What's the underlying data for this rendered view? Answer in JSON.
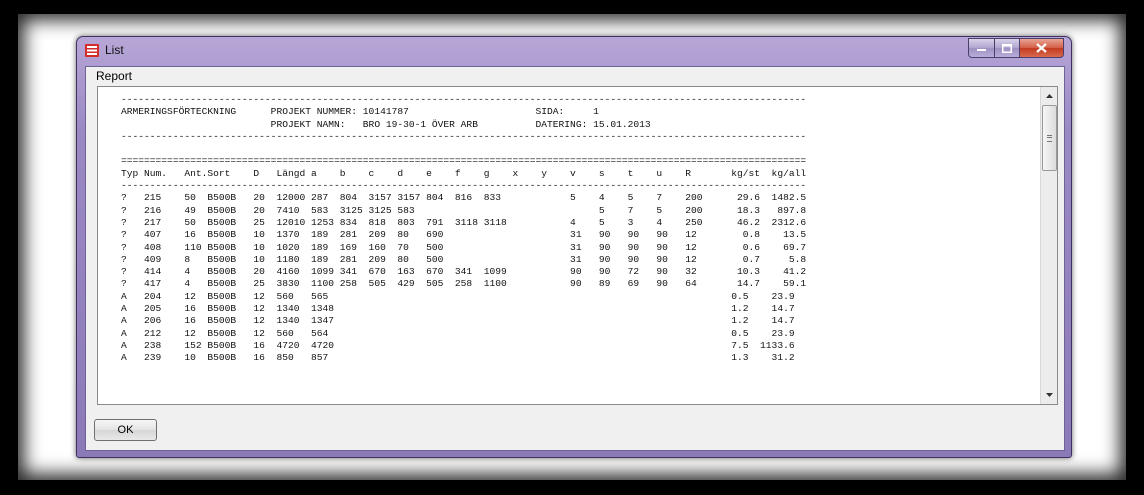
{
  "window": {
    "title": "List"
  },
  "menu": {
    "report_label": "Report"
  },
  "report": {
    "lines": [
      "-----------------------------------------------------------------------------------------------------------------------",
      "ARMERINGSFÖRTECKNING      PROJEKT NUMMER: 10141787                      SIDA:     1",
      "                          PROJEKT NAMN:   BRO 19-30-1 ÖVER ARB          DATERING: 15.01.2013",
      "-----------------------------------------------------------------------------------------------------------------------",
      "",
      "=======================================================================================================================",
      "Typ Num.   Ant.Sort    D   Längd a    b    c    d    e    f    g    x    y    v    s    t    u    R       kg/st  kg/all",
      "-----------------------------------------------------------------------------------------------------------------------",
      "?   215    50  B500B   20  12000 287  804  3157 3157 804  816  833            5    4    5    7    200      29.6  1482.5",
      "?   216    49  B500B   20  7410  583  3125 3125 583                                5    7    5    200      18.3   897.8",
      "?   217    50  B500B   25  12010 1253 834  818  803  791  3118 3118           4    5    3    4    250      46.2  2312.6",
      "?   407    16  B500B   10  1370  189  281  209  80   690                      31   90   90   90   12        0.8    13.5",
      "?   408    110 B500B   10  1020  189  169  160  70   500                      31   90   90   90   12        0.6    69.7",
      "?   409    8   B500B   10  1180  189  281  209  80   500                      31   90   90   90   12        0.7     5.8",
      "?   414    4   B500B   20  4160  1099 341  670  163  670  341  1099           90   90   72   90   32       10.3    41.2",
      "?   417    4   B500B   25  3830  1100 258  505  429  505  258  1100           90   89   69   90   64       14.7    59.1",
      "A   204    12  B500B   12  560   565                                                                      0.5    23.9",
      "A   205    16  B500B   12  1340  1348                                                                     1.2    14.7",
      "A   206    16  B500B   12  1340  1347                                                                     1.2    14.7",
      "A   212    12  B500B   12  560   564                                                                      0.5    23.9",
      "A   238    152 B500B   16  4720  4720                                                                     7.5  1133.6",
      "A   239    10  B500B   16  850   857                                                                      1.3    31.2"
    ]
  },
  "buttons": {
    "ok_label": "OK"
  },
  "icons": {
    "app": "list-app-icon",
    "minimize": "minimize-icon",
    "maximize": "maximize-icon",
    "close": "close-icon",
    "scroll_up": "scroll-up-arrow-icon",
    "scroll_down": "scroll-down-arrow-icon"
  },
  "colors": {
    "titlebar": "#9b89c4",
    "close_button": "#c43a20"
  }
}
